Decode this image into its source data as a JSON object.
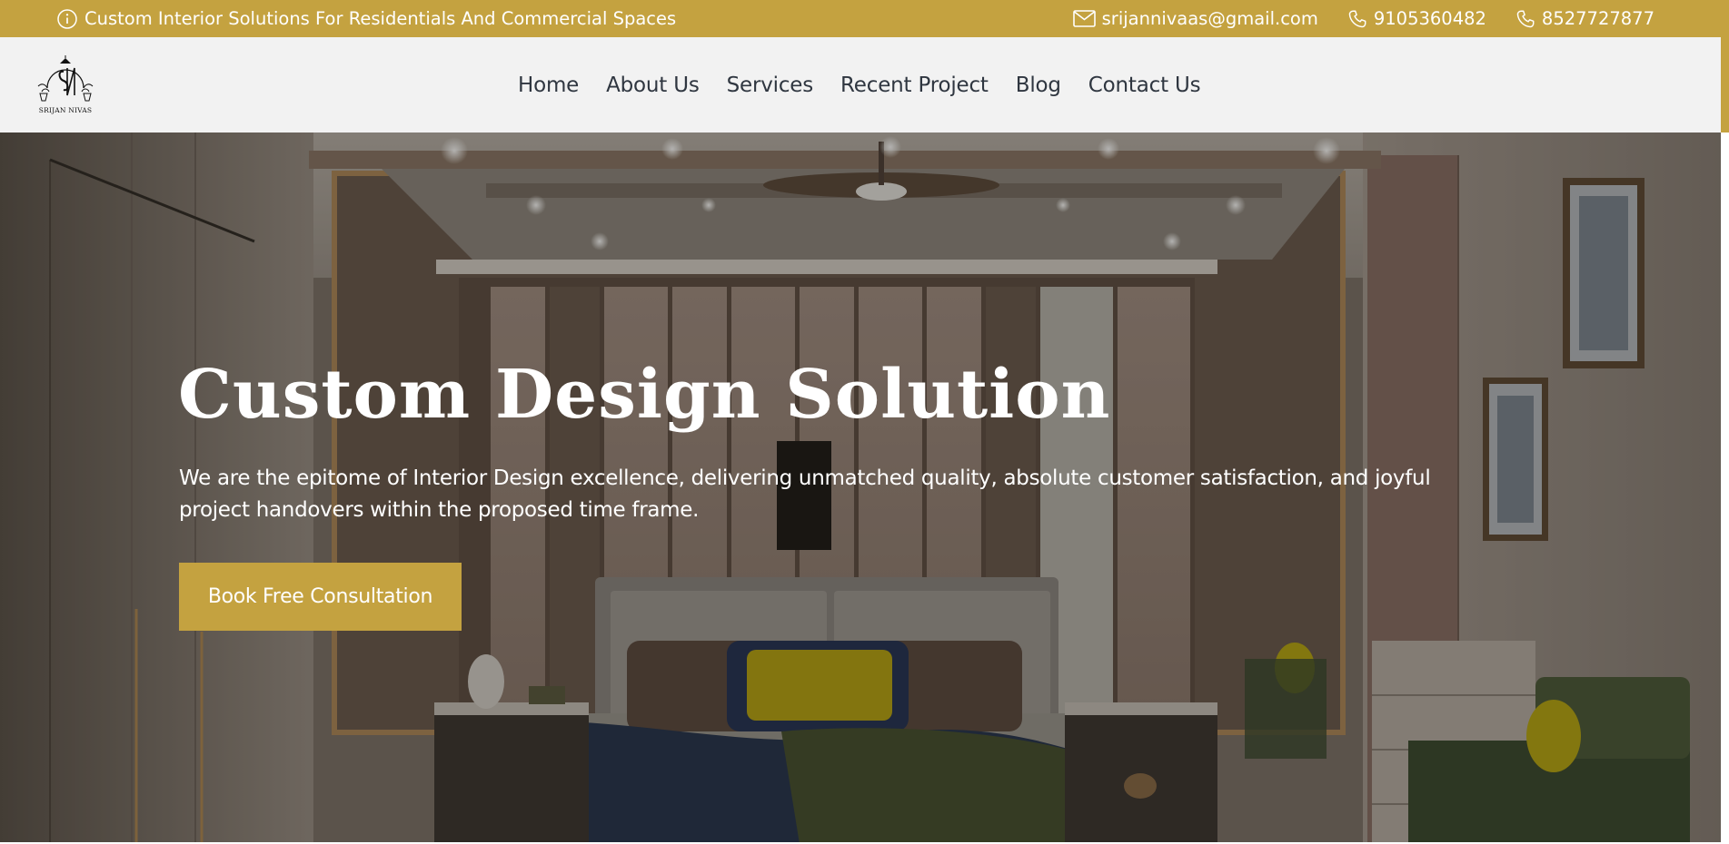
{
  "topbar": {
    "tagline": "Custom Interior Solutions For Residentials And Commercial Spaces",
    "email": "srijannivaas@gmail.com",
    "phones": [
      "9105360482",
      "8527727877"
    ]
  },
  "brand": {
    "logo_text": "SRIJAN NIVAS"
  },
  "nav": {
    "items": [
      {
        "label": "Home"
      },
      {
        "label": "About Us"
      },
      {
        "label": "Services"
      },
      {
        "label": "Recent Project"
      },
      {
        "label": "Blog"
      },
      {
        "label": "Contact Us"
      }
    ]
  },
  "hero": {
    "title": "Custom Design Solution",
    "text": "We are the epitome of Interior Design excellence, delivering unmatched quality, absolute customer satisfaction, and joyful project handovers within the proposed time frame.",
    "cta_label": "Book Free Consultation",
    "image": "bedroom-interior-photo"
  },
  "colors": {
    "accent": "#c4a240",
    "nav_bg": "#f2f2f2",
    "nav_text": "#2f3640"
  },
  "icons": {
    "tagline": "info-icon",
    "email": "mail-icon",
    "phone": "phone-icon"
  }
}
